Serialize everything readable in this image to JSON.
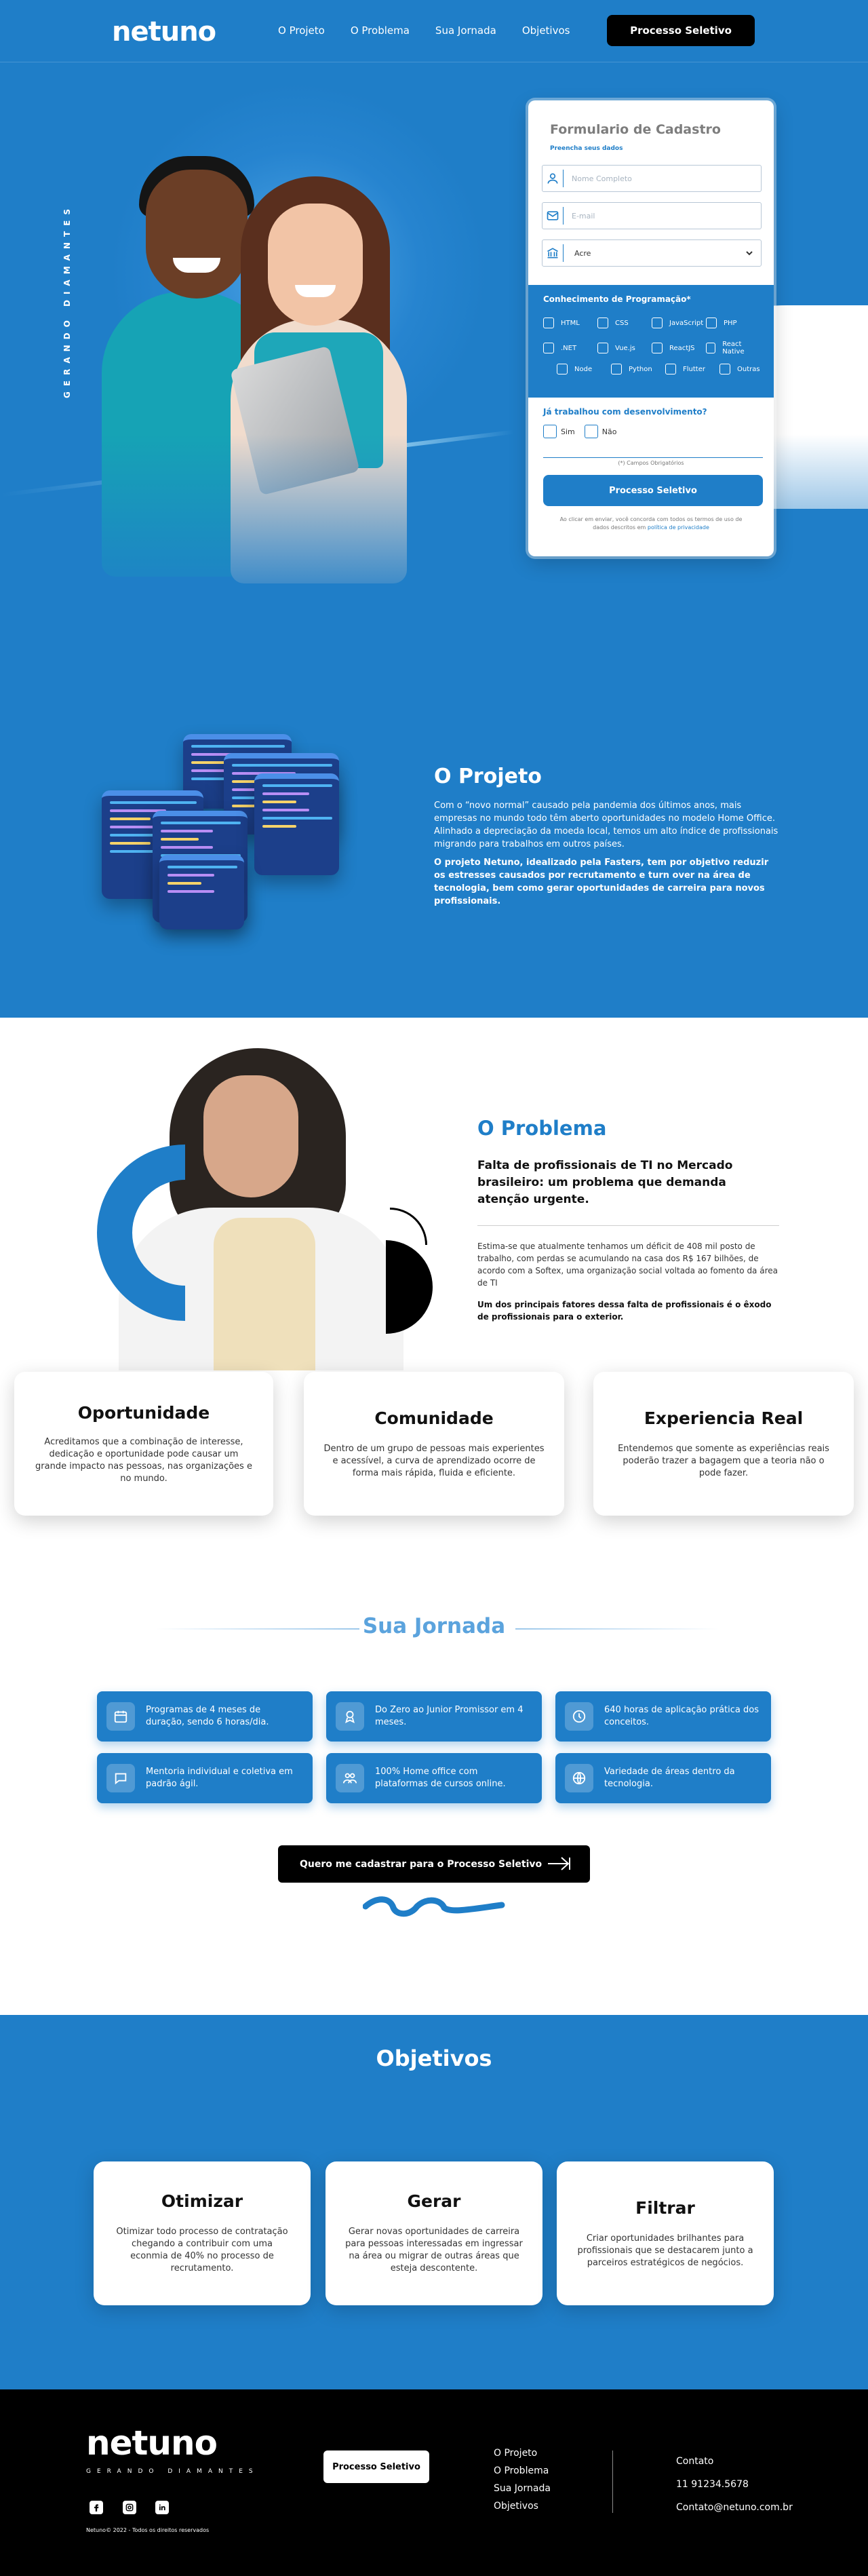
{
  "header": {
    "logo": "netuno",
    "nav": [
      "O Projeto",
      "O Problema",
      "Sua Jornada",
      "Objetivos"
    ],
    "cta": "Processo Seletivo"
  },
  "hero": {
    "vertical_tag": "GERANDO DIAMANTES"
  },
  "form": {
    "title": "Formulario de Cadastro",
    "subtitle": "Preencha seus dados",
    "name_placeholder": "Nome Completo",
    "email_placeholder": "E-mail",
    "state_value": "Acre",
    "skills_title": "Conhecimento de Programação*",
    "skills": [
      "HTML",
      "CSS",
      "JavaScript",
      "PHP",
      ".NET",
      "Vue.js",
      "ReactJS",
      "React Native",
      "Node",
      "Python",
      "Flutter",
      "Outras"
    ],
    "experience_question": "Já trabalhou com desenvolvimento?",
    "options": [
      "Sim",
      "Não"
    ],
    "required_note": "(*) Campos Obrigatórios",
    "submit": "Processo Seletivo",
    "terms_text": "Ao clicar em enviar, você concorda com todos os termos de uso de dados descritos em",
    "terms_link": "política de privacidade"
  },
  "projeto": {
    "title": "O Projeto",
    "text": "Com o “novo normal” causado pela pandemia dos últimos anos, mais empresas no mundo todo têm aberto oportunidades no modelo Home Office. Alinhado a depreciação da moeda local, temos um alto índice de profissionais migrando para trabalhos em outros países.",
    "text_bold": "O projeto Netuno, idealizado pela Fasters, tem por objetivo reduzir os estresses causados por recrutamento e turn over na área de tecnologia, bem como gerar oportunidades de carreira para novos profissionais."
  },
  "problema": {
    "title": "O Problema",
    "subtitle": "Falta de profissionais de TI no Mercado brasileiro: um problema que demanda atenção urgente.",
    "text": "Estima-se que atualmente tenhamos um déficit de 408 mil posto de trabalho, com perdas se acumulando na casa dos R$ 167 bilhões, de acordo com a Softex, uma organização social voltada ao fomento da área de TI",
    "text_bold": "Um dos principais fatores dessa falta de profissionais é o êxodo de profissionais para o exterior.",
    "cards": [
      {
        "title": "Oportunidade",
        "text": "Acreditamos que a combinação de interesse, dedicação e oportunidade pode causar um grande impacto nas pessoas, nas organizações e no mundo."
      },
      {
        "title": "Comunidade",
        "text": "Dentro de um grupo de pessoas mais experientes e acessível, a curva de aprendizado ocorre de forma mais rápida, fluida e eficiente."
      },
      {
        "title": "Experiencia Real",
        "text": "Entendemos que somente as experiências reais poderão trazer a bagagem que a teoria não o pode fazer."
      }
    ]
  },
  "jornada": {
    "title": "Sua Jornada",
    "items": [
      {
        "icon": "calendar-icon",
        "text": "Programas de 4 meses de duração, sendo 6 horas/dia."
      },
      {
        "icon": "badge-icon",
        "text": "Do Zero ao Junior Promissor em 4 meses."
      },
      {
        "icon": "clock-icon",
        "text": "640 horas de aplicação prática dos conceitos."
      },
      {
        "icon": "chat-icon",
        "text": "Mentoria individual e coletiva em padrão ágil."
      },
      {
        "icon": "team-icon",
        "text": "100% Home office com plataformas de cursos online."
      },
      {
        "icon": "globe-icon",
        "text": "Variedade de áreas dentro da tecnologia."
      }
    ],
    "cta": "Quero me cadastrar para o Processo Seletivo"
  },
  "objetivos": {
    "title": "Objetivos",
    "cards": [
      {
        "title": "Otimizar",
        "text": "Otimizar todo processo de contratação chegando a contribuir com uma econmia de 40% no processo de recrutamento."
      },
      {
        "title": "Gerar",
        "text": "Gerar novas oportunidades de carreira para pessoas interessadas em ingressar na área ou migrar de outras áreas que esteja descontente."
      },
      {
        "title": "Filtrar",
        "text": "Criar oportunidades brilhantes para profissionais que se destacarem junto a parceiros estratégicos de negócios."
      }
    ]
  },
  "footer": {
    "logo": "netuno",
    "tagline": "GERANDO DIAMANTES",
    "copyright": "Netuno© 2022 - Todos os direitos reservados",
    "cta": "Processo Seletivo",
    "links": [
      "O Projeto",
      "O Problema",
      "Sua Jornada",
      "Objetivos"
    ],
    "contact_label": "Contato",
    "phone": "11 91234.5678",
    "email": "Contato@netuno.com.br"
  },
  "colors": {
    "primary": "#1f7ec8",
    "dark": "#000000",
    "light": "#ffffff"
  }
}
